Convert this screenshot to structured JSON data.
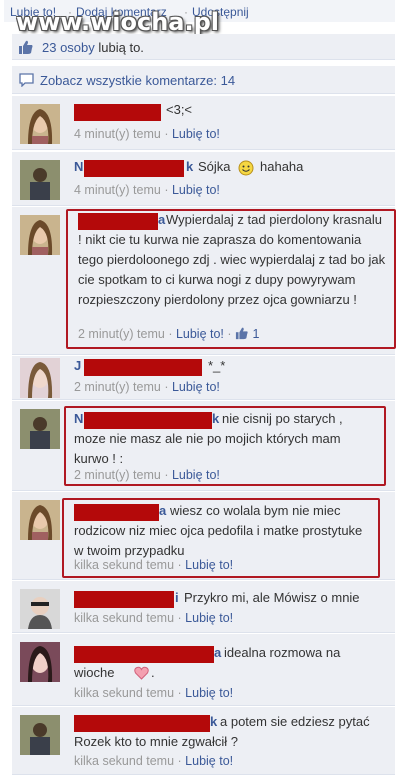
{
  "top_links": [
    "Lubię to!",
    "Dodaj komentarz",
    "Udostępnij"
  ],
  "watermark": "www.wiocha.pl",
  "likes": {
    "link": "23 osoby",
    "rest": "lubią to."
  },
  "see_all": "Zobacz wszystkie komentarze: 14",
  "like_label": "Lubię to!",
  "comments": [
    {
      "prefix": "",
      "text": "<3;<",
      "time": "4 minut(y) temu"
    },
    {
      "prefix": "N",
      "suffix": "k",
      "text": "Sójka",
      "text2": "hahaha",
      "time": "4 minut(y) temu"
    },
    {
      "prefix": "",
      "suffix": "a",
      "text": "Wypierdalaj z tad pierdolony krasnalu ! nikt cie tu kurwa nie zaprasza do komentowania tego pierdoloonego zdj . wiec wypierdalaj z tad bo jak cie spotkam to ci kurwa nogi z dupy powyrywam rozpieszczony pierdolony przez ojca gowniarzu !",
      "time": "2 minut(y) temu",
      "likes": "1"
    },
    {
      "prefix": "J",
      "text": "*_*",
      "time": "2 minut(y) temu"
    },
    {
      "prefix": "N",
      "suffix": "k",
      "text": "nie cisnij po starych , moze nie masz ale nie po mojich których mam kurwo ! :",
      "time": "2 minut(y) temu"
    },
    {
      "prefix": "",
      "suffix": "a",
      "text": "wiesz co wolala bym nie miec rodzicow niz miec ojca pedofila i matke prostytuke w twoim przypadku",
      "time": "kilka sekund temu"
    },
    {
      "prefix": "",
      "suffix": "i",
      "text": "Przykro mi, ale Mówisz o mnie",
      "time": "kilka sekund temu"
    },
    {
      "prefix": "",
      "suffix": "a",
      "text": "idealna rozmowa na wioche",
      "time": "kilka sekund temu"
    },
    {
      "prefix": "",
      "suffix": "k",
      "text": "a potem sie edziesz pytać Rozek kto to mnie zgwałcił ?",
      "time": "kilka sekund temu"
    }
  ],
  "colors": {
    "link": "#3b5998",
    "redact": "#b4090a",
    "highlight": "#b01822",
    "bg": "#edeff4"
  }
}
